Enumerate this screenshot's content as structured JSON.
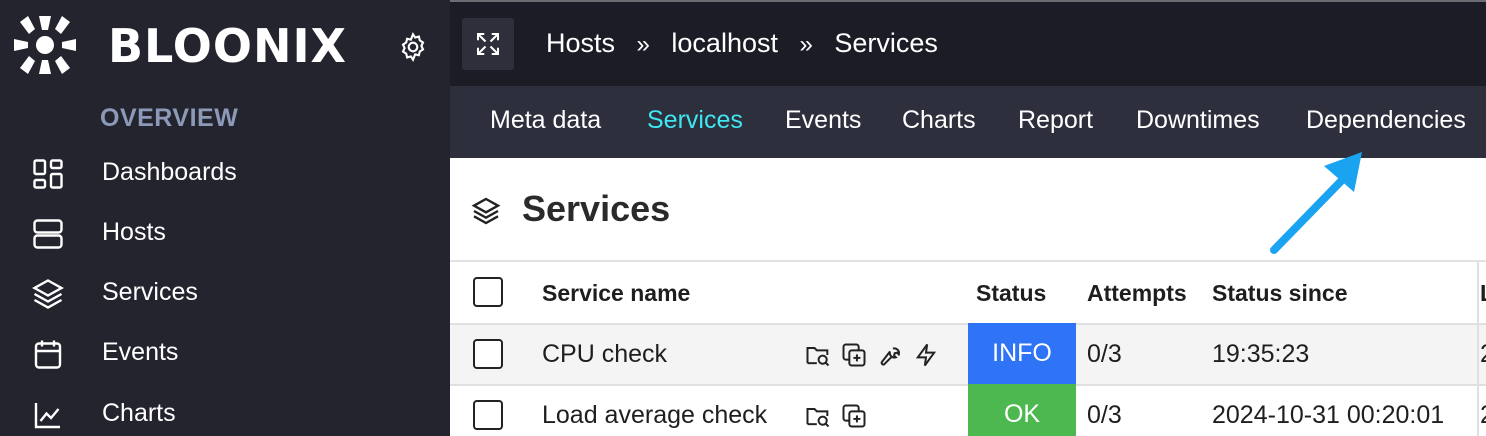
{
  "app": {
    "brand": "BLOONIX"
  },
  "sidebar": {
    "section_title": "OVERVIEW",
    "items": [
      {
        "label": "Dashboards",
        "icon": "dashboard-icon"
      },
      {
        "label": "Hosts",
        "icon": "server-icon"
      },
      {
        "label": "Services",
        "icon": "layers-icon"
      },
      {
        "label": "Events",
        "icon": "calendar-icon"
      },
      {
        "label": "Charts",
        "icon": "chart-icon"
      }
    ]
  },
  "breadcrumb": {
    "items": [
      "Hosts",
      "localhost",
      "Services"
    ],
    "separator": "»"
  },
  "tabs": [
    {
      "label": "Meta data",
      "active": false
    },
    {
      "label": "Services",
      "active": true
    },
    {
      "label": "Events",
      "active": false
    },
    {
      "label": "Charts",
      "active": false
    },
    {
      "label": "Report",
      "active": false
    },
    {
      "label": "Downtimes",
      "active": false
    },
    {
      "label": "Dependencies",
      "active": false
    }
  ],
  "page": {
    "title": "Services"
  },
  "table": {
    "columns": [
      "Service name",
      "Status",
      "Attempts",
      "Status since",
      "L"
    ],
    "rows": [
      {
        "service": "CPU check",
        "status": "INFO",
        "attempts": "0/3",
        "since": "19:35:23",
        "next": "2"
      },
      {
        "service": "Load average check",
        "status": "OK",
        "attempts": "0/3",
        "since": "2024-10-31 00:20:01",
        "next": "2"
      }
    ]
  },
  "colors": {
    "accent": "#3ee6f0",
    "info": "#2f73f7",
    "ok": "#4db84f",
    "sidebar_bg": "#23242e",
    "annotation_arrow": "#1aa3f0"
  }
}
